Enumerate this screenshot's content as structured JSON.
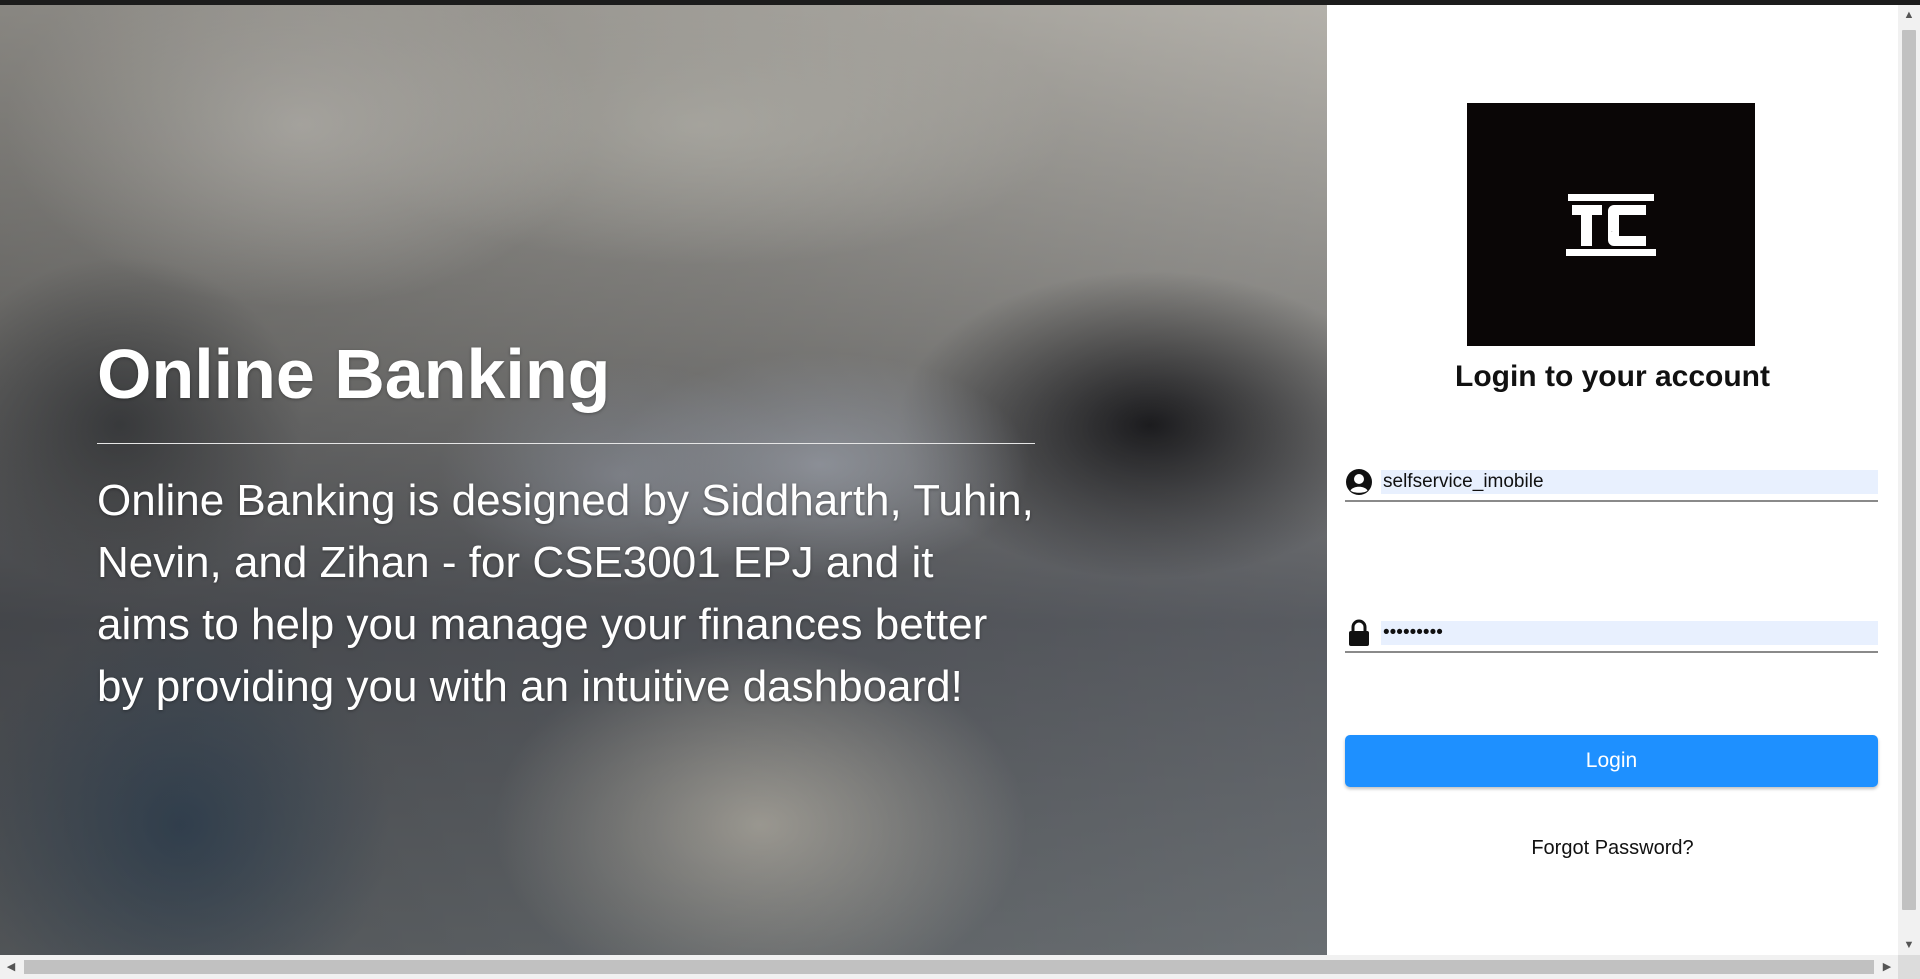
{
  "hero": {
    "title": "Online Banking",
    "description": "Online Banking is designed by Siddharth, Tuhin, Nevin, and Zihan - for CSE3001 EPJ and it aims to help you manage your finances better by providing you with an intuitive dashboard!"
  },
  "login": {
    "logo_text": "TC",
    "heading": "Login to your account",
    "username": {
      "value": "selfservice_imobile",
      "icon": "user-circle-icon"
    },
    "password": {
      "value": "•••••••••",
      "icon": "lock-icon"
    },
    "button_label": "Login",
    "forgot_label": "Forgot Password?"
  },
  "colors": {
    "accent": "#1e90ff",
    "autofill_bg": "#e8f0fe",
    "logo_bg": "#0a0606"
  }
}
